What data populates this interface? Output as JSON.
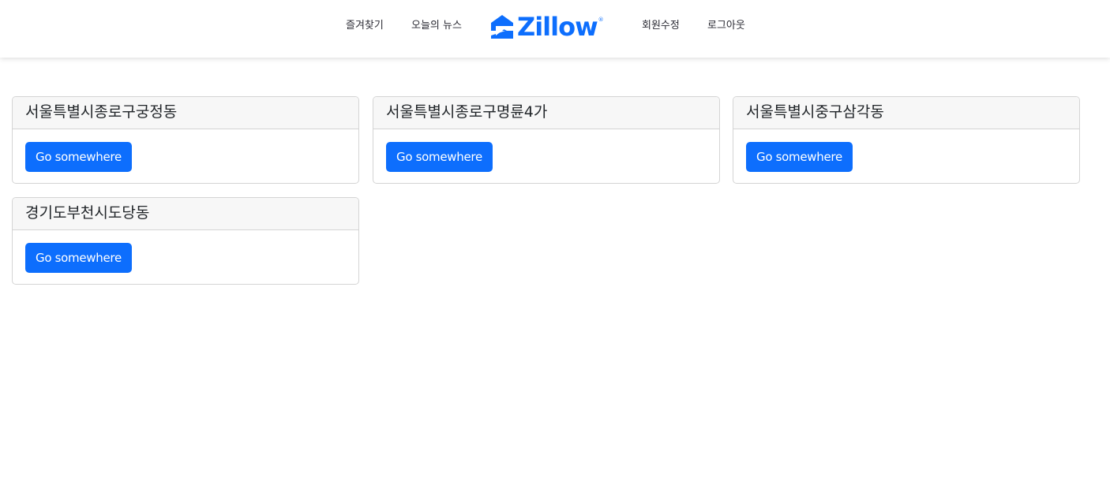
{
  "nav": {
    "favorites": "즐겨찾기",
    "news": "오늘의 뉴스",
    "logo_text": "Zillow",
    "logo_reg": "®",
    "edit_profile": "회원수정",
    "logout": "로그아웃"
  },
  "brand_color": "#0d6efd",
  "cards": [
    {
      "title": "서울특별시종로구궁정동",
      "button": "Go somewhere"
    },
    {
      "title": "서울특별시종로구명륜4가",
      "button": "Go somewhere"
    },
    {
      "title": "서울특별시중구삼각동",
      "button": "Go somewhere"
    },
    {
      "title": "경기도부천시도당동",
      "button": "Go somewhere"
    }
  ]
}
